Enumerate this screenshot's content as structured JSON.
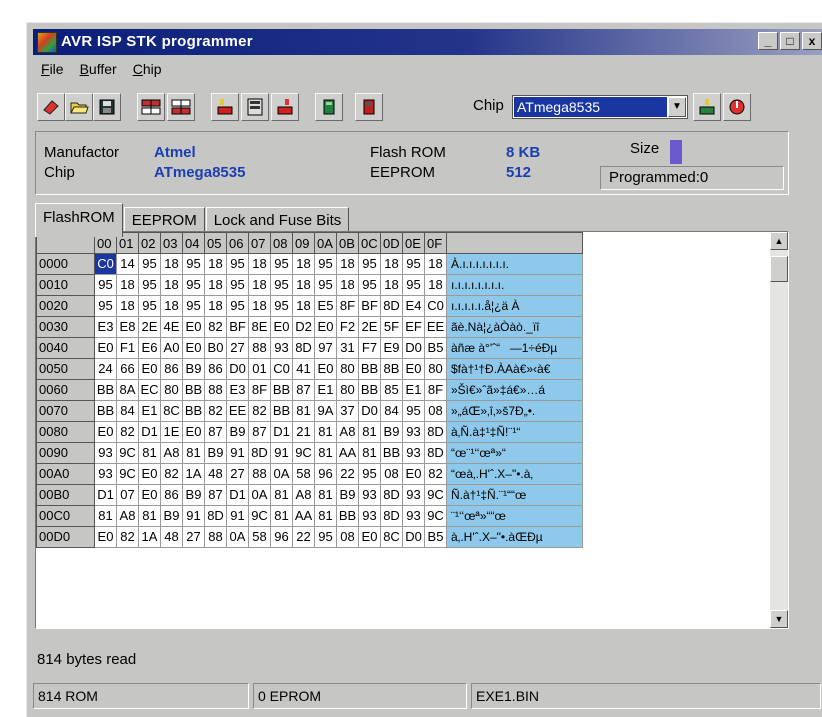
{
  "window": {
    "title": "AVR ISP STK programmer"
  },
  "window_buttons": [
    "_",
    "□",
    "x"
  ],
  "menu": [
    {
      "label": "File",
      "accel": "F",
      "rest": "ile"
    },
    {
      "label": "Buffer",
      "accel": "B",
      "rest": "uffer"
    },
    {
      "label": "Chip",
      "accel": "C",
      "rest": "hip"
    }
  ],
  "toolbar": {
    "icons": [
      "eraser-icon",
      "open-folder-icon",
      "save-disk-icon",
      "read-flash-icon",
      "write-flash-icon",
      "read-eeprom-icon",
      "buffer-icon",
      "write-eeprom-icon",
      "verify-icon",
      "chip-icon"
    ],
    "chip_label": "Chip",
    "chip_value": "ATmega8535",
    "chip_icons": [
      "chip-program-icon",
      "chip-reset-icon"
    ]
  },
  "info": {
    "manufacturer_label": "Manufactor",
    "manufacturer_value": "Atmel",
    "chip_label": "Chip",
    "chip_value": "ATmega8535",
    "flash_label": "Flash ROM",
    "flash_value": "8 KB",
    "eeprom_label": "EEPROM",
    "eeprom_value": "512",
    "size_label": "Size",
    "programmed": "Programmed:0"
  },
  "tabs": [
    "FlashROM",
    "EEPROM",
    "Lock and Fuse Bits"
  ],
  "grid": {
    "columns": [
      "00",
      "01",
      "02",
      "03",
      "04",
      "05",
      "06",
      "07",
      "08",
      "09",
      "0A",
      "0B",
      "0C",
      "0D",
      "0E",
      "0F"
    ],
    "rows": [
      {
        "addr": "0000",
        "bytes": [
          "C0",
          "14",
          "95",
          "18",
          "95",
          "18",
          "95",
          "18",
          "95",
          "18",
          "95",
          "18",
          "95",
          "18",
          "95",
          "18"
        ],
        "ascii": "À.ı.ı.ı.ı.ı.ı.ı."
      },
      {
        "addr": "0010",
        "bytes": [
          "95",
          "18",
          "95",
          "18",
          "95",
          "18",
          "95",
          "18",
          "95",
          "18",
          "95",
          "18",
          "95",
          "18",
          "95",
          "18"
        ],
        "ascii": "ı.ı.ı.ı.ı.ı.ı.ı."
      },
      {
        "addr": "0020",
        "bytes": [
          "95",
          "18",
          "95",
          "18",
          "95",
          "18",
          "95",
          "18",
          "95",
          "18",
          "E5",
          "8F",
          "BF",
          "8D",
          "E4",
          "C0"
        ],
        "ascii": "ı.ı.ı.ı.ı.å¦¿ä À"
      },
      {
        "addr": "0030",
        "bytes": [
          "E3",
          "E8",
          "2E",
          "4E",
          "E0",
          "82",
          "BF",
          "8E",
          "E0",
          "D2",
          "E0",
          "F2",
          "2E",
          "5F",
          "EF",
          "EE"
        ],
        "ascii": "ãè.Nà¦¿àÒàò._ïî"
      },
      {
        "addr": "0040",
        "bytes": [
          "E0",
          "F1",
          "E6",
          "A0",
          "E0",
          "B0",
          "27",
          "88",
          "93",
          "8D",
          "97",
          "31",
          "F7",
          "E9",
          "D0",
          "B5"
        ],
        "ascii": "àñæ à°'ˆ“—1÷éÐµ"
      },
      {
        "addr": "0050",
        "bytes": [
          "24",
          "66",
          "E0",
          "86",
          "B9",
          "86",
          "D0",
          "01",
          "C0",
          "41",
          "E0",
          "80",
          "BB",
          "8B",
          "E0",
          "80"
        ],
        "ascii": "$fà†¹†Ð.ÀAà€»‹à€"
      },
      {
        "addr": "0060",
        "bytes": [
          "BB",
          "8A",
          "EC",
          "80",
          "BB",
          "88",
          "E3",
          "8F",
          "BB",
          "87",
          "E1",
          "80",
          "BB",
          "85",
          "E1",
          "8F"
        ],
        "ascii": "»Šì€»ˆã»‡á€»…á"
      },
      {
        "addr": "0070",
        "bytes": [
          "BB",
          "84",
          "E1",
          "8C",
          "BB",
          "82",
          "EE",
          "82",
          "BB",
          "81",
          "9A",
          "37",
          "D0",
          "84",
          "95",
          "08"
        ],
        "ascii": "»„áŒ»‚î‚»š7Ð„•."
      },
      {
        "addr": "0080",
        "bytes": [
          "E0",
          "82",
          "D1",
          "1E",
          "E0",
          "87",
          "B9",
          "87",
          "D1",
          "21",
          "81",
          "A8",
          "81",
          "B9",
          "93",
          "8D"
        ],
        "ascii": "à‚Ñ.à‡¹‡Ñ!¨¹“"
      },
      {
        "addr": "0090",
        "bytes": [
          "93",
          "9C",
          "81",
          "A8",
          "81",
          "B9",
          "91",
          "8D",
          "91",
          "9C",
          "81",
          "AA",
          "81",
          "BB",
          "93",
          "8D"
        ],
        "ascii": "“œ¨¹‘‘œª»“"
      },
      {
        "addr": "00A0",
        "bytes": [
          "93",
          "9C",
          "E0",
          "82",
          "1A",
          "48",
          "27",
          "88",
          "0A",
          "58",
          "96",
          "22",
          "95",
          "08",
          "E0",
          "82"
        ],
        "ascii": "“œà‚.H'ˆ.X–\"•.à‚"
      },
      {
        "addr": "00B0",
        "bytes": [
          "D1",
          "07",
          "E0",
          "86",
          "B9",
          "87",
          "D1",
          "0A",
          "81",
          "A8",
          "81",
          "B9",
          "93",
          "8D",
          "93",
          "9C"
        ],
        "ascii": "Ñ.à†¹‡Ñ.¨¹““œ"
      },
      {
        "addr": "00C0",
        "bytes": [
          "81",
          "A8",
          "81",
          "B9",
          "91",
          "8D",
          "91",
          "9C",
          "81",
          "AA",
          "81",
          "BB",
          "93",
          "8D",
          "93",
          "9C"
        ],
        "ascii": "¨¹‘‘œª»““œ"
      },
      {
        "addr": "00D0",
        "bytes": [
          "E0",
          "82",
          "1A",
          "48",
          "27",
          "88",
          "0A",
          "58",
          "96",
          "22",
          "95",
          "08",
          "E0",
          "8C",
          "D0",
          "B5"
        ],
        "ascii": "à‚.H'ˆ.X–\"•.àŒÐµ"
      }
    ]
  },
  "status_message": "814 bytes read",
  "statusbar": {
    "rom": "814 ROM",
    "eprom": "0 EPROM",
    "file": "EXE1.BIN"
  },
  "colors": {
    "title_start": "#0a1f7a",
    "selection": "#1a36a0",
    "ascii_bg": "#8ec8ea",
    "info_blue": "#1c3fb0"
  }
}
